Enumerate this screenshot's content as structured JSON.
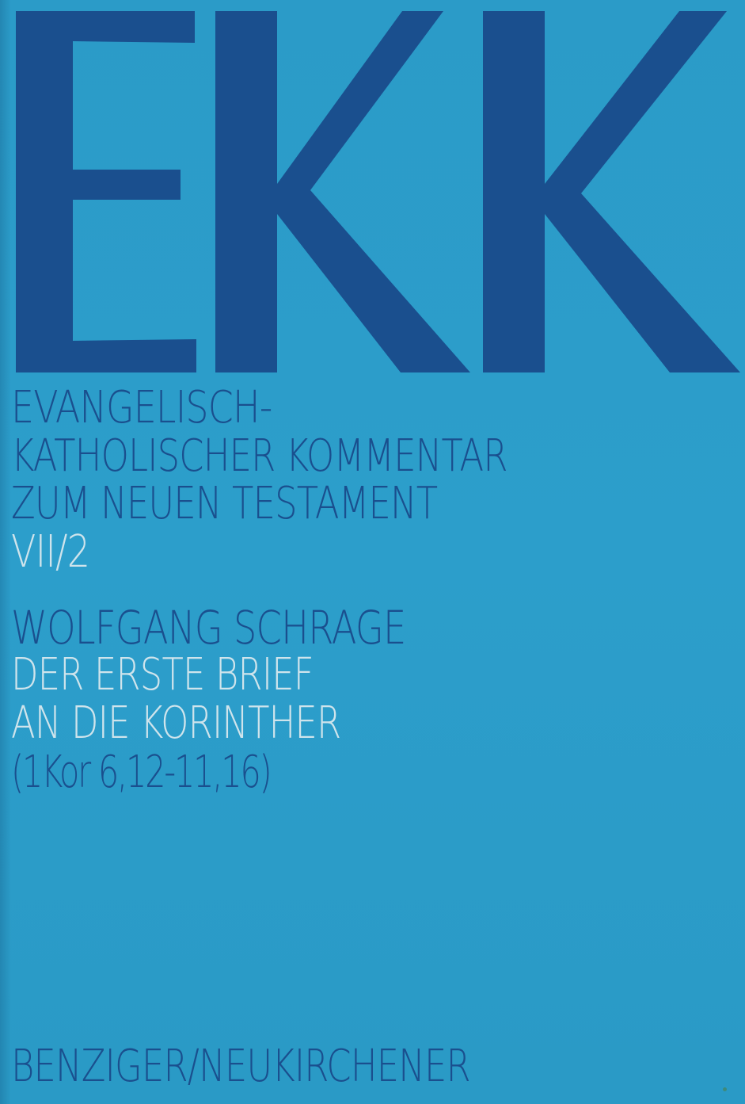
{
  "cover": {
    "logo": "EKK",
    "series_lines": [
      "EVANGELISCH-",
      "KATHOLISCHER KOMMENTAR",
      "ZUM NEUEN TESTAMENT"
    ],
    "volume": "VII/2",
    "author": "WOLFGANG SCHRAGE",
    "title_lines": [
      "DER ERSTE BRIEF",
      "AN DIE KORINTHER"
    ],
    "scripture_range": "(1Kor 6,12-11,16)",
    "publisher": "BENZIGER/NEUKIRCHENER"
  },
  "colors": {
    "background": "#2a9ac6",
    "dark_text": "#1a4f8e",
    "light_text": "#cfe4ec"
  }
}
